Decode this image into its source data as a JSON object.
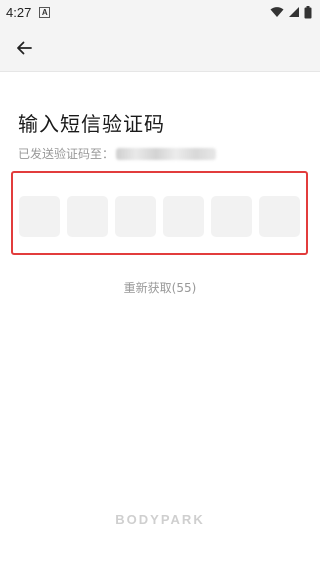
{
  "status_bar": {
    "time": "4:27",
    "notification_glyph": "A",
    "icons": [
      "wifi-icon",
      "signal-icon",
      "battery-icon"
    ]
  },
  "header": {
    "back_icon": "arrow-left-icon"
  },
  "main": {
    "title": "输入短信验证码",
    "subtitle": "已发送验证码至：",
    "code_cells": [
      "",
      "",
      "",
      "",
      "",
      ""
    ],
    "resend_label": "重新获取(55)"
  },
  "footer": {
    "brand": "BODYPARK"
  },
  "colors": {
    "highlight_border": "#e23c3c",
    "header_bg": "#f4f4f4",
    "cell_bg": "#f2f2f2",
    "muted_text": "#999999"
  }
}
